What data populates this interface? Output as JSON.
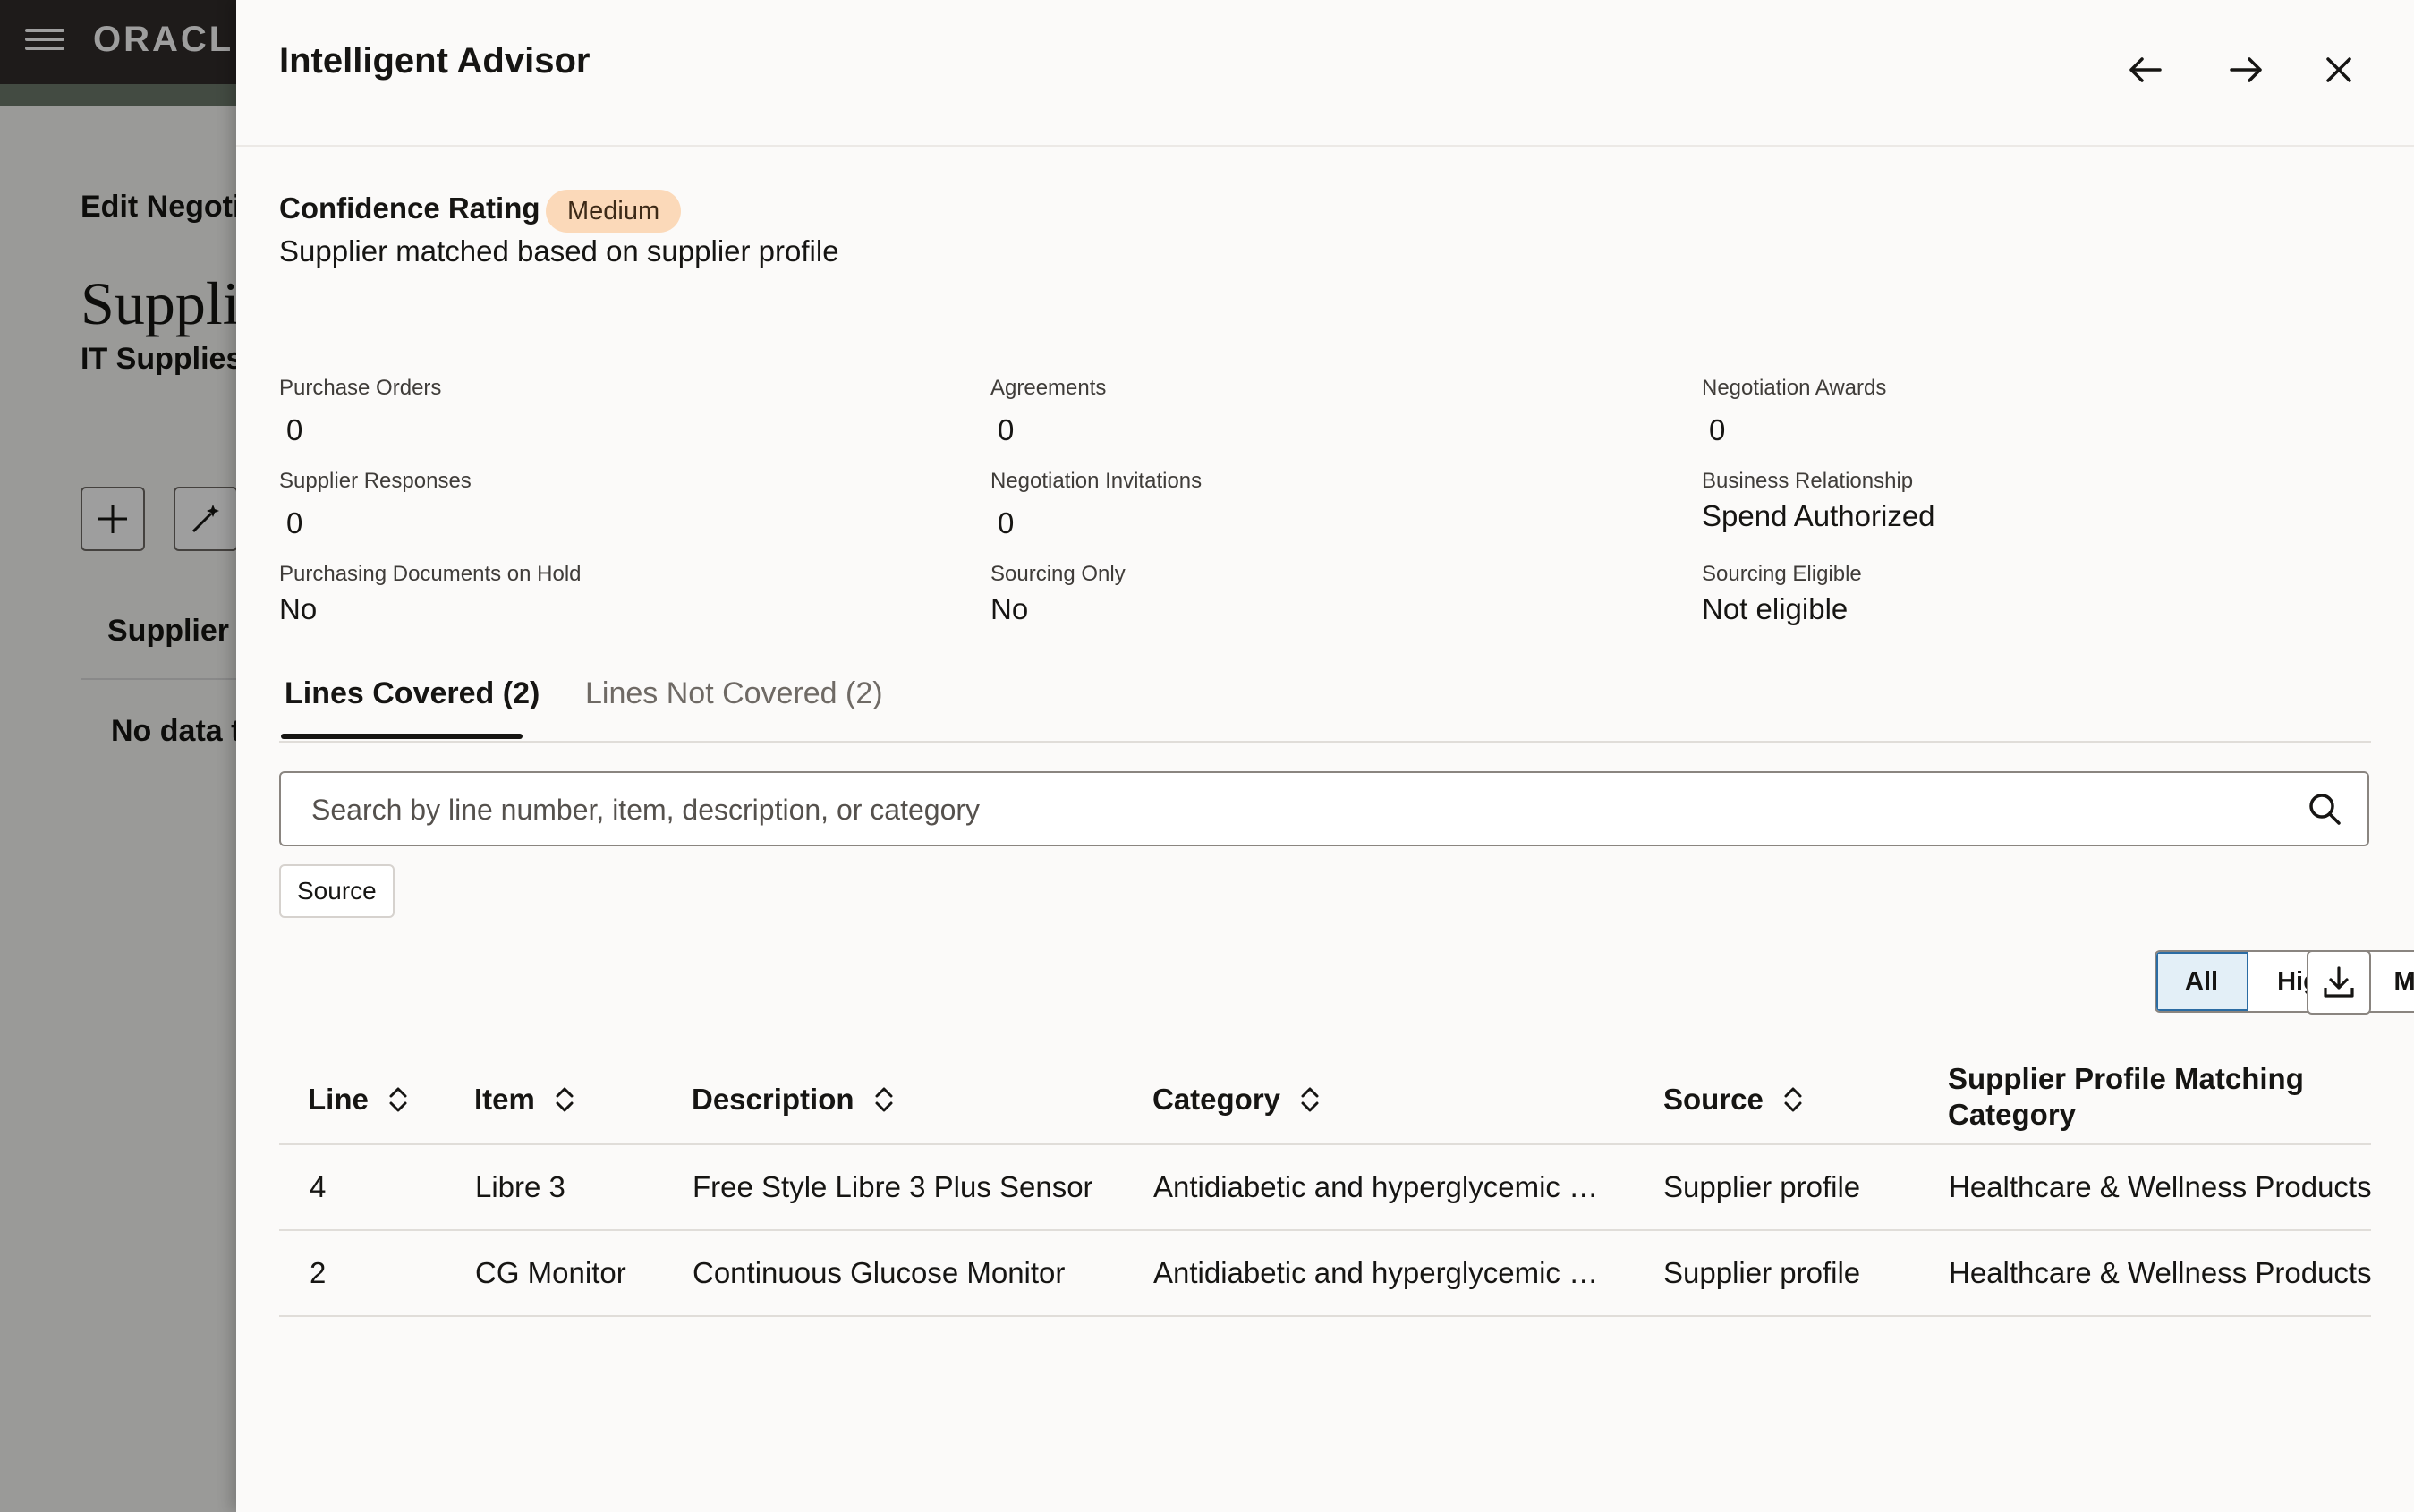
{
  "background": {
    "logo": "ORACL",
    "breadcrumb": "Edit Negotia",
    "page_title": "Suppli",
    "page_subtitle": "IT Supplies",
    "column_header": "Supplier *",
    "no_data": "No data t"
  },
  "drawer": {
    "title": "Intelligent Advisor",
    "confidence": {
      "label": "Confidence Rating",
      "badge": "Medium",
      "description": "Supplier matched based on supplier profile"
    },
    "metrics": {
      "purchase_orders": {
        "label": "Purchase Orders",
        "value": "0"
      },
      "agreements": {
        "label": "Agreements",
        "value": "0"
      },
      "negotiation_awards": {
        "label": "Negotiation Awards",
        "value": "0"
      },
      "supplier_responses": {
        "label": "Supplier Responses",
        "value": "0"
      },
      "negotiation_invitations": {
        "label": "Negotiation Invitations",
        "value": "0"
      },
      "business_relationship": {
        "label": "Business Relationship",
        "value": "Spend Authorized"
      },
      "purchasing_docs_on_hold": {
        "label": "Purchasing Documents on Hold",
        "value": "No"
      },
      "sourcing_only": {
        "label": "Sourcing Only",
        "value": "No"
      },
      "sourcing_eligible": {
        "label": "Sourcing Eligible",
        "value": "Not eligible"
      }
    },
    "tabs": [
      {
        "label": "Lines Covered (2)"
      },
      {
        "label": "Lines Not Covered (2)"
      }
    ],
    "search": {
      "placeholder": "Search by line number, item, description, or category",
      "value": ""
    },
    "filter_chip": "Source",
    "segments": [
      {
        "label": "All"
      },
      {
        "label": "High"
      },
      {
        "label": "Medium"
      }
    ],
    "table": {
      "columns": [
        "Line",
        "Item",
        "Description",
        "Category",
        "Source",
        "Supplier Profile Matching",
        "Category"
      ],
      "rows": [
        {
          "line": "4",
          "item": "Libre 3",
          "description": "Free Style Libre 3 Plus Sensor",
          "category": "Antidiabetic and hyperglycemic …",
          "source": "Supplier profile",
          "matching": "Healthcare & Wellness Products"
        },
        {
          "line": "2",
          "item": "CG Monitor",
          "description": "Continuous Glucose Monitor",
          "category": "Antidiabetic and hyperglycemic …",
          "source": "Supplier profile",
          "matching": "Healthcare & Wellness Products"
        }
      ]
    }
  },
  "colors": {
    "badge_medium": "#fbd9b9",
    "selected_segment": "#e3eff7",
    "header_bar": "#312d2a"
  },
  "icons": [
    "menu-icon",
    "arrow-left-icon",
    "arrow-right-icon",
    "close-icon",
    "search-icon",
    "sort-icon",
    "download-icon",
    "plus-icon",
    "magic-wand-icon"
  ]
}
